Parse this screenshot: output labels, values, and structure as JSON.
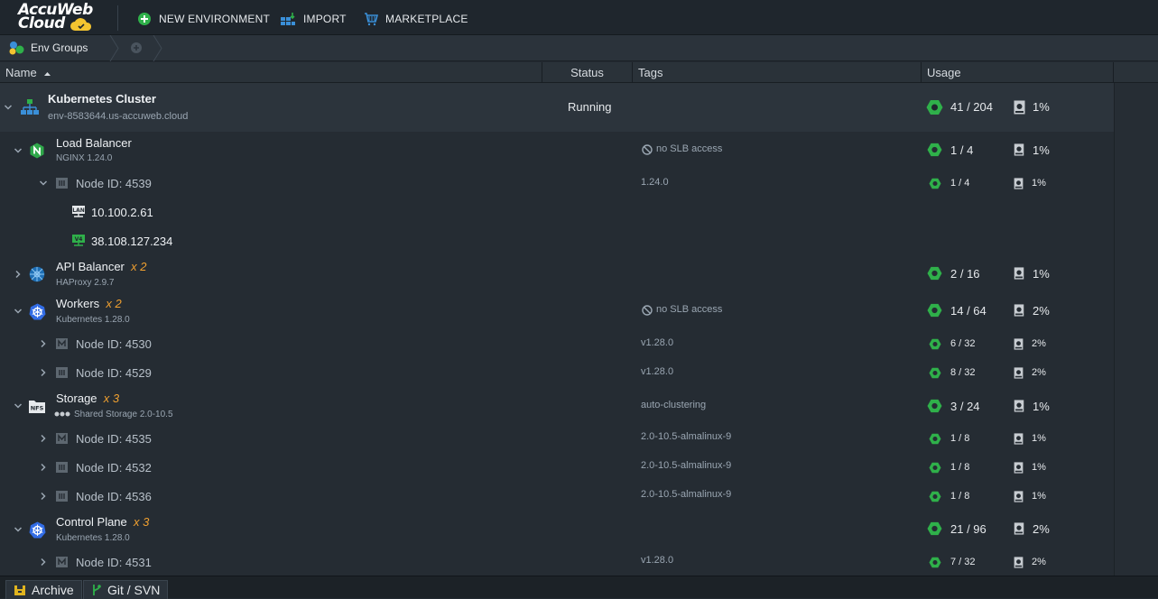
{
  "app": {
    "logo_line1": "AccuWeb",
    "logo_line2": "Cloud"
  },
  "toolbar": {
    "new_env_label": "NEW ENVIRONMENT",
    "import_label": "IMPORT",
    "marketplace_label": "MARKETPLACE"
  },
  "breadcrumb": {
    "env_groups_label": "Env Groups"
  },
  "columns": {
    "name": "Name",
    "status": "Status",
    "tags": "Tags",
    "usage": "Usage"
  },
  "environment": {
    "name": "Kubernetes Cluster",
    "domain": "env-8583644.us-accuweb.cloud",
    "status": "Running",
    "cloudlets": "41 / 204",
    "disk": "1%"
  },
  "load_balancer": {
    "name": "Load Balancer",
    "version": "NGINX 1.24.0",
    "tag": "no SLB access",
    "cloudlets": "1 / 4",
    "disk": "1%",
    "node": {
      "label": "Node ID: 4539",
      "tag": "1.24.0",
      "cloudlets": "1 / 4",
      "disk": "1%",
      "ip_private": "10.100.2.61",
      "ip_public": "38.108.127.234",
      "ip_private_badge": "LAN",
      "ip_public_badge": "V4"
    }
  },
  "api_balancer": {
    "name": "API Balancer",
    "count": "x 2",
    "version": "HAProxy 2.9.7",
    "cloudlets": "2 / 16",
    "disk": "1%"
  },
  "workers": {
    "name": "Workers",
    "count": "x 2",
    "version": "Kubernetes 1.28.0",
    "tag": "no SLB access",
    "cloudlets": "14 / 64",
    "disk": "2%",
    "nodes": [
      {
        "label": "Node ID: 4530",
        "tag": "v1.28.0",
        "cloudlets": "6 / 32",
        "disk": "2%"
      },
      {
        "label": "Node ID: 4529",
        "tag": "v1.28.0",
        "cloudlets": "8 / 32",
        "disk": "2%"
      }
    ]
  },
  "storage": {
    "name": "Storage",
    "count": "x 3",
    "version": "Shared Storage 2.0-10.5",
    "badge": "NFS",
    "tag": "auto-clustering",
    "cloudlets": "3 / 24",
    "disk": "1%",
    "nodes": [
      {
        "label": "Node ID: 4535",
        "tag": "2.0-10.5-almalinux-9",
        "cloudlets": "1 / 8",
        "disk": "1%"
      },
      {
        "label": "Node ID: 4532",
        "tag": "2.0-10.5-almalinux-9",
        "cloudlets": "1 / 8",
        "disk": "1%"
      },
      {
        "label": "Node ID: 4536",
        "tag": "2.0-10.5-almalinux-9",
        "cloudlets": "1 / 8",
        "disk": "1%"
      }
    ]
  },
  "control_plane": {
    "name": "Control Plane",
    "count": "x 3",
    "version": "Kubernetes 1.28.0",
    "cloudlets": "21 / 96",
    "disk": "2%",
    "nodes": [
      {
        "label": "Node ID: 4531",
        "tag": "v1.28.0",
        "cloudlets": "7 / 32",
        "disk": "2%"
      }
    ]
  },
  "bottom_tabs": {
    "archive": "Archive",
    "git": "Git / SVN"
  },
  "colors": {
    "accent_green": "#2fb04a",
    "multiplier": "#f0a030",
    "background": "#252c33"
  }
}
